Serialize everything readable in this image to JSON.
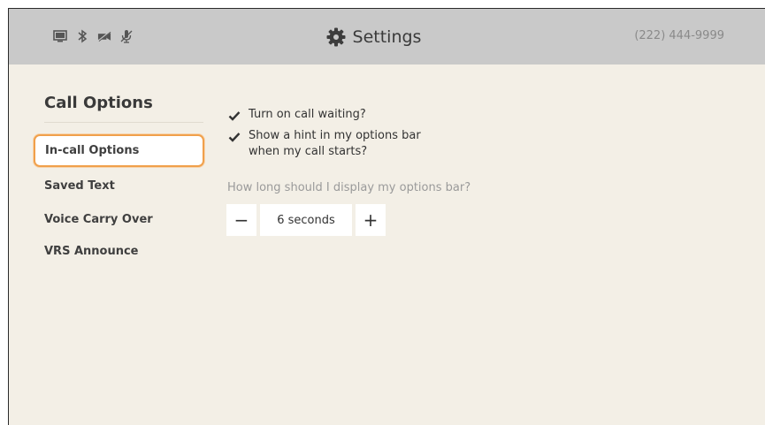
{
  "header": {
    "title": "Settings",
    "phone_number": "(222) 444-9999",
    "status_icons": [
      "screen-icon",
      "bluetooth-icon",
      "camera-off-icon",
      "mic-off-icon"
    ]
  },
  "sidebar": {
    "title": "Call Options",
    "items": [
      {
        "label": "In-call Options",
        "selected": true
      },
      {
        "label": "Saved Text",
        "selected": false
      },
      {
        "label": "Voice Carry Over",
        "selected": false
      },
      {
        "label": "VRS Announce",
        "selected": false
      }
    ]
  },
  "main": {
    "options": [
      {
        "label_line1": "Turn on call waiting?",
        "label_line2": "",
        "checked": true
      },
      {
        "label_line1": "Show a hint in my options bar",
        "label_line2": "when my call starts?",
        "checked": true
      }
    ],
    "duration_question": "How long should I display my options bar?",
    "duration": {
      "decrement_label": "−",
      "value": "6 seconds",
      "increment_label": "+"
    }
  },
  "colors": {
    "topbar": "#c9c9c9",
    "background": "#f3efe6",
    "focus_accent": "#f0a04b"
  }
}
